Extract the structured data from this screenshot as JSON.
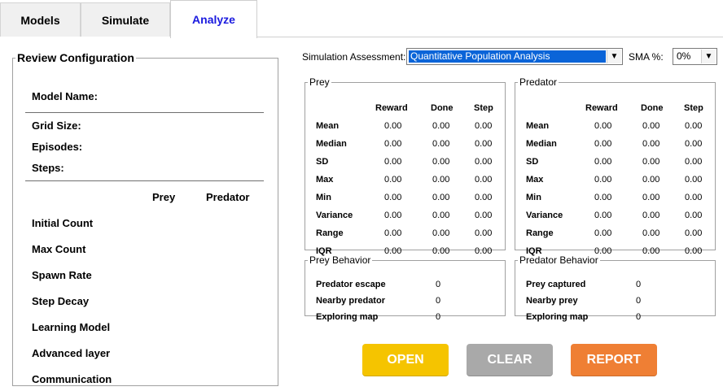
{
  "tabs": [
    {
      "label": "Models"
    },
    {
      "label": "Simulate"
    },
    {
      "label": "Analyze"
    }
  ],
  "review": {
    "title": "Review Configuration",
    "model_name": "Model Name:",
    "grid_size": "Grid Size:",
    "episodes": "Episodes:",
    "steps": "Steps:",
    "col_prey": "Prey",
    "col_predator": "Predator",
    "rows": [
      "Initial Count",
      "Max Count",
      "Spawn Rate",
      "Step Decay",
      "Learning Model",
      "Advanced layer",
      "Communication"
    ]
  },
  "assessment": {
    "label": "Simulation Assessment:",
    "value": "Quantitative Population Analysis"
  },
  "sma": {
    "label": "SMA %:",
    "value": "0%"
  },
  "prey_stats": {
    "title": "Prey",
    "columns": [
      "Reward",
      "Done",
      "Step"
    ],
    "rows": [
      {
        "label": "Mean",
        "values": [
          "0.00",
          "0.00",
          "0.00"
        ]
      },
      {
        "label": "Median",
        "values": [
          "0.00",
          "0.00",
          "0.00"
        ]
      },
      {
        "label": "SD",
        "values": [
          "0.00",
          "0.00",
          "0.00"
        ]
      },
      {
        "label": "Max",
        "values": [
          "0.00",
          "0.00",
          "0.00"
        ]
      },
      {
        "label": "Min",
        "values": [
          "0.00",
          "0.00",
          "0.00"
        ]
      },
      {
        "label": "Variance",
        "values": [
          "0.00",
          "0.00",
          "0.00"
        ]
      },
      {
        "label": "Range",
        "values": [
          "0.00",
          "0.00",
          "0.00"
        ]
      },
      {
        "label": "IQR",
        "values": [
          "0.00",
          "0.00",
          "0.00"
        ]
      }
    ]
  },
  "predator_stats": {
    "title": "Predator",
    "columns": [
      "Reward",
      "Done",
      "Step"
    ],
    "rows": [
      {
        "label": "Mean",
        "values": [
          "0.00",
          "0.00",
          "0.00"
        ]
      },
      {
        "label": "Median",
        "values": [
          "0.00",
          "0.00",
          "0.00"
        ]
      },
      {
        "label": "SD",
        "values": [
          "0.00",
          "0.00",
          "0.00"
        ]
      },
      {
        "label": "Max",
        "values": [
          "0.00",
          "0.00",
          "0.00"
        ]
      },
      {
        "label": "Min",
        "values": [
          "0.00",
          "0.00",
          "0.00"
        ]
      },
      {
        "label": "Variance",
        "values": [
          "0.00",
          "0.00",
          "0.00"
        ]
      },
      {
        "label": "Range",
        "values": [
          "0.00",
          "0.00",
          "0.00"
        ]
      },
      {
        "label": "IQR",
        "values": [
          "0.00",
          "0.00",
          "0.00"
        ]
      }
    ]
  },
  "prey_behavior": {
    "title": "Prey Behavior",
    "rows": [
      {
        "label": "Predator escape",
        "value": "0"
      },
      {
        "label": "Nearby predator",
        "value": "0"
      },
      {
        "label": "Exploring map",
        "value": "0"
      }
    ]
  },
  "predator_behavior": {
    "title": "Predator Behavior",
    "rows": [
      {
        "label": "Prey captured",
        "value": "0"
      },
      {
        "label": "Nearby prey",
        "value": "0"
      },
      {
        "label": "Exploring map",
        "value": "0"
      }
    ]
  },
  "buttons": {
    "open": "OPEN",
    "clear": "CLEAR",
    "report": "REPORT"
  },
  "colors": {
    "active_tab_text": "#1a1adf",
    "open_button": "#f5c400",
    "clear_button": "#a9a9a9",
    "report_button": "#ef7f34",
    "selection": "#0a64d8"
  },
  "icons": {
    "dropdown": "chevron-down-icon"
  }
}
